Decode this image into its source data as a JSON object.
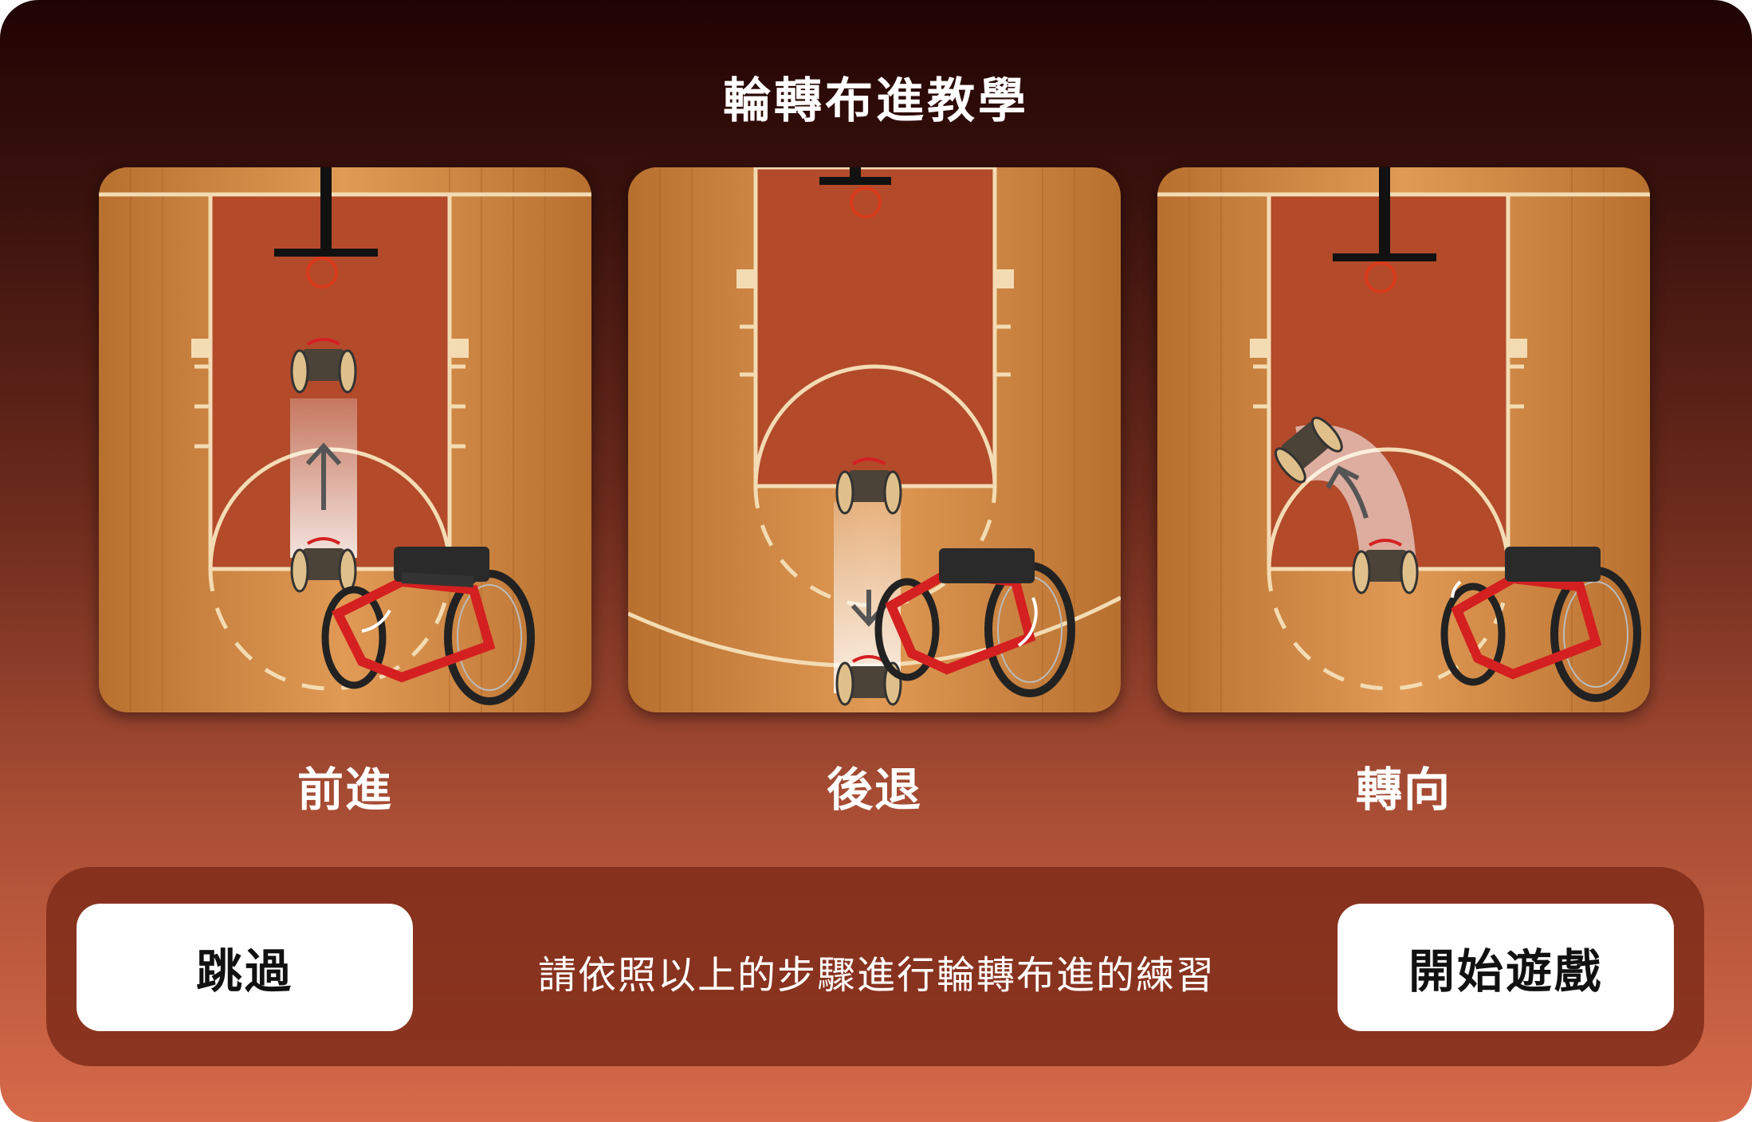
{
  "header": {
    "title": "輪轉布進教學"
  },
  "cards": [
    {
      "label": "前進",
      "icon": "wheelchair-forward-diagram"
    },
    {
      "label": "後退",
      "icon": "wheelchair-backward-diagram"
    },
    {
      "label": "轉向",
      "icon": "wheelchair-turn-diagram"
    }
  ],
  "footer": {
    "skip_label": "跳過",
    "instruction": "請依照以上的步驟進行輪轉布進的練習",
    "start_label": "開始遊戲"
  },
  "colors": {
    "court_wood": "#d08a45",
    "paint": "#b34a2a",
    "wheelchair_frame": "#d42020",
    "button_bg": "#ffffff"
  }
}
